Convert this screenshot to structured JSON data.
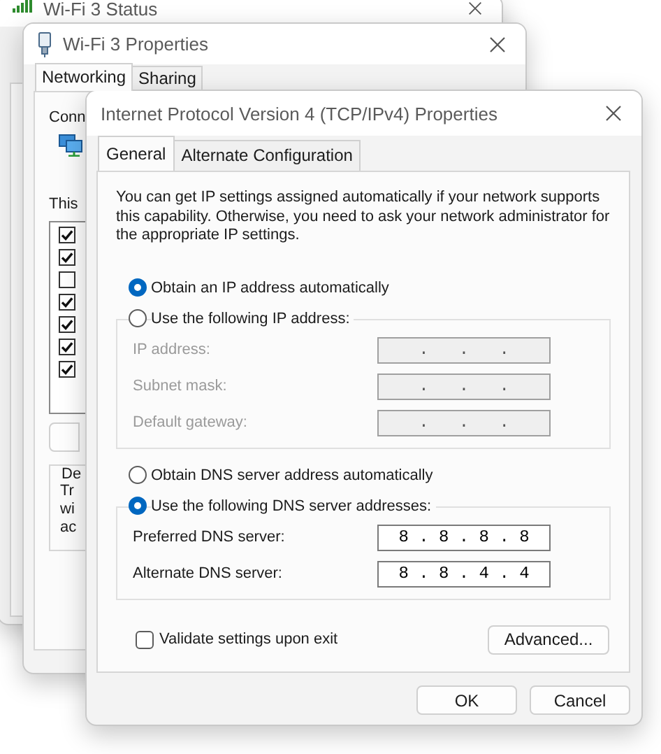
{
  "status_window": {
    "title": "Wi-Fi 3 Status"
  },
  "properties_window": {
    "title": "Wi-Fi 3 Properties",
    "tabs": [
      {
        "label": "Networking",
        "selected": true
      },
      {
        "label": "Sharing",
        "selected": false
      }
    ],
    "connect_label": "Conn",
    "items_label": "This",
    "components": [
      {
        "checked": true
      },
      {
        "checked": true
      },
      {
        "checked": false
      },
      {
        "checked": true
      },
      {
        "checked": true
      },
      {
        "checked": true
      },
      {
        "checked": true
      }
    ],
    "description_title": "De",
    "description_lines": [
      "Tr",
      "wi",
      "ac"
    ]
  },
  "ipv4_window": {
    "title": "Internet Protocol Version 4 (TCP/IPv4) Properties",
    "tabs": [
      {
        "label": "General",
        "selected": true
      },
      {
        "label": "Alternate Configuration",
        "selected": false
      }
    ],
    "intro": "You can get IP settings assigned automatically if your network supports this capability. Otherwise, you need to ask your network administrator for the appropriate IP settings.",
    "ip_options": [
      {
        "label": "Obtain an IP address automatically",
        "selected": true
      },
      {
        "label": "Use the following IP address:",
        "selected": false
      }
    ],
    "ip_fields": [
      {
        "label": "IP address:",
        "value": ".   .   .",
        "disabled": true
      },
      {
        "label": "Subnet mask:",
        "value": ".   .   .",
        "disabled": true
      },
      {
        "label": "Default gateway:",
        "value": ".   .   .",
        "disabled": true
      }
    ],
    "dns_options": [
      {
        "label": "Obtain DNS server address automatically",
        "selected": false
      },
      {
        "label": "Use the following DNS server addresses:",
        "selected": true
      }
    ],
    "dns_fields": [
      {
        "label": "Preferred DNS server:",
        "value": "8 . 8 . 8 . 8",
        "disabled": false
      },
      {
        "label": "Alternate DNS server:",
        "value": "8 . 8 . 4 . 4",
        "disabled": false
      }
    ],
    "validate": {
      "label": "Validate settings upon exit",
      "checked": false
    },
    "advanced_button": "Advanced...",
    "buttons": [
      "OK",
      "Cancel"
    ]
  }
}
